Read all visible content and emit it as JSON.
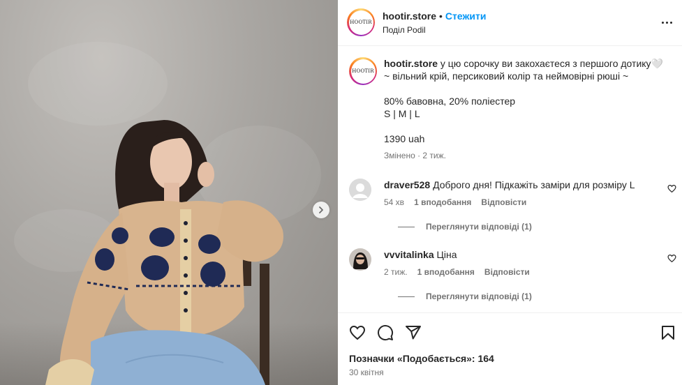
{
  "post": {
    "username": "hootir.store",
    "follow_label": "Стежити",
    "location": "Поділ Podil",
    "avatar_logo_text": "HOOTIR"
  },
  "caption": {
    "username": "hootir.store",
    "lines": [
      "у цю сорочку ви закохаєтеся з першого дотику🤍",
      "~ вільний крій, персиковий колір та неймовірні рюші ~",
      "",
      "80% бавовна, 20% поліестер",
      "S | M | L",
      "",
      "1390 uah"
    ],
    "meta": "Змінено · 2 тиж."
  },
  "comments": [
    {
      "username": "draver528",
      "text": "Доброго дня! Підкажіть заміри для розміру L",
      "time": "54 хв",
      "likes": "1 вподобання",
      "reply": "Відповісти",
      "view_replies": "Переглянути відповіді (1)"
    },
    {
      "username": "vvvitalinka",
      "text": "Ціна",
      "time": "2 тиж.",
      "likes": "1 вподобання",
      "reply": "Відповісти",
      "view_replies": "Переглянути відповіді (1)"
    }
  ],
  "footer": {
    "likes_label": "Позначки «Подобається»: 164",
    "date": "30 квітня"
  },
  "icons": {
    "more": "more-options-icon",
    "heart": "heart-icon",
    "comment": "comment-icon",
    "share": "share-icon",
    "save": "bookmark-icon",
    "next": "chevron-right-icon"
  }
}
